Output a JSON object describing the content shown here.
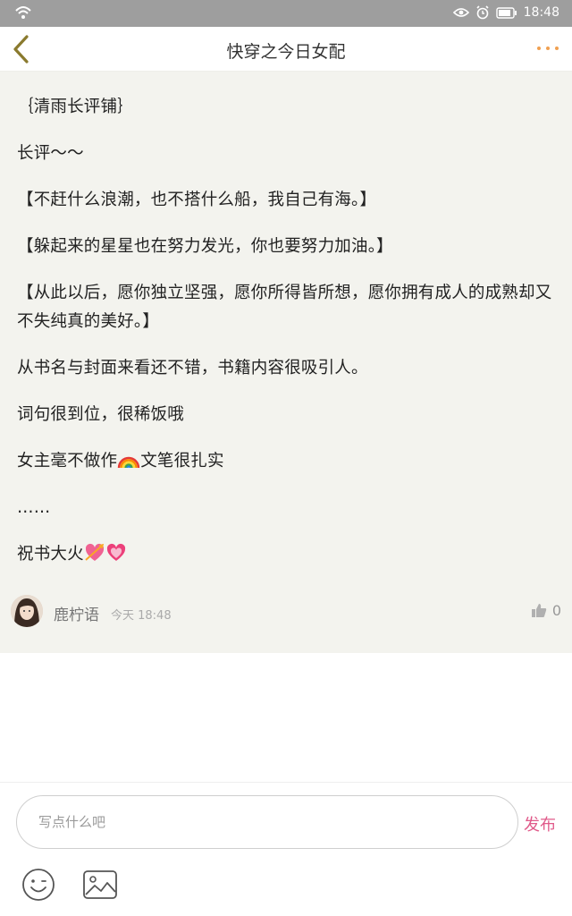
{
  "status_bar": {
    "time": "18:48",
    "icons": [
      "wifi-icon",
      "eye-icon",
      "alarm-icon",
      "battery-icon"
    ]
  },
  "navbar": {
    "title": "快穿之今日女配",
    "back_icon": "chevron-left-icon",
    "more_icon": "more-dots-icon",
    "accent_color": "#f0a050"
  },
  "review": {
    "paragraphs": [
      "｛清雨长评铺｝",
      "长评～～",
      "【不赶什么浪潮，也不搭什么船，我自己有海。】",
      "【躲起来的星星也在努力发光，你也要努力加油。】",
      "【从此以后，愿你独立坚强，愿你所得皆所想，愿你拥有成人的成熟却又不失纯真的美好。】",
      "从书名与封面来看还不错，书籍内容很吸引人。",
      "词句很到位，很稀饭哦"
    ],
    "line_rainbow_text_before": "女主毫不做作",
    "line_rainbow_text_after": "文笔很扎实",
    "ellipsis": "……",
    "closing_text": "祝书大火",
    "emoji_icons": [
      "rainbow-icon",
      "heart-arrow-icon",
      "sparkling-heart-icon"
    ]
  },
  "author": {
    "name": "鹿柠语",
    "time": "今天 18:48",
    "like_count": "0",
    "like_icon": "thumbs-up-icon"
  },
  "comment_box": {
    "placeholder": "写点什么吧",
    "publish_label": "发布",
    "publish_color": "#e05a8a",
    "tools": [
      "emoji-icon",
      "image-icon"
    ]
  }
}
